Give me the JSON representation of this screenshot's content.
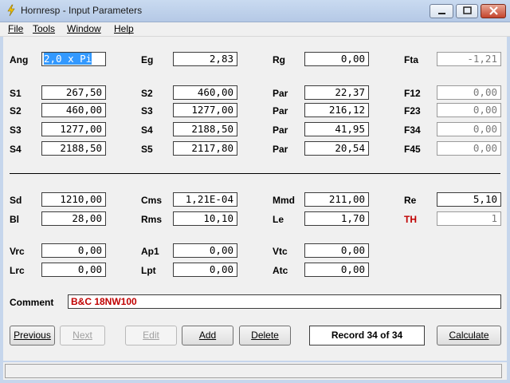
{
  "window": {
    "title": "Hornresp - Input Parameters"
  },
  "menu": [
    "File",
    "Tools",
    "Window",
    "Help"
  ],
  "rows1": [
    [
      {
        "l": "Ang",
        "v": "2,0 x Pi",
        "state": "selected"
      },
      {
        "l": "Eg",
        "v": "2,83"
      },
      {
        "l": "Rg",
        "v": "0,00"
      },
      {
        "l": "Fta",
        "v": "-1,21",
        "state": "readonly"
      }
    ]
  ],
  "rows2": [
    [
      {
        "l": "S1",
        "v": "267,50"
      },
      {
        "l": "S2",
        "v": "460,00"
      },
      {
        "l": "Par",
        "v": "22,37"
      },
      {
        "l": "F12",
        "v": "0,00",
        "state": "readonly"
      }
    ],
    [
      {
        "l": "S2",
        "v": "460,00"
      },
      {
        "l": "S3",
        "v": "1277,00"
      },
      {
        "l": "Par",
        "v": "216,12"
      },
      {
        "l": "F23",
        "v": "0,00",
        "state": "readonly"
      }
    ],
    [
      {
        "l": "S3",
        "v": "1277,00"
      },
      {
        "l": "S4",
        "v": "2188,50"
      },
      {
        "l": "Par",
        "v": "41,95"
      },
      {
        "l": "F34",
        "v": "0,00",
        "state": "readonly"
      }
    ],
    [
      {
        "l": "S4",
        "v": "2188,50"
      },
      {
        "l": "S5",
        "v": "2117,80"
      },
      {
        "l": "Par",
        "v": "20,54"
      },
      {
        "l": "F45",
        "v": "0,00",
        "state": "readonly"
      }
    ]
  ],
  "rows3": [
    [
      {
        "l": "Sd",
        "v": "1210,00"
      },
      {
        "l": "Cms",
        "v": "1,21E-04"
      },
      {
        "l": "Mmd",
        "v": "211,00"
      },
      {
        "l": "Re",
        "v": "5,10"
      }
    ],
    [
      {
        "l": "Bl",
        "v": "28,00"
      },
      {
        "l": "Rms",
        "v": "10,10"
      },
      {
        "l": "Le",
        "v": "1,70"
      },
      {
        "l": "TH",
        "v": "1",
        "state": "readonly",
        "color": "#c00000"
      }
    ]
  ],
  "rows4": [
    [
      {
        "l": "Vrc",
        "v": "0,00"
      },
      {
        "l": "Ap1",
        "v": "0,00"
      },
      {
        "l": "Vtc",
        "v": "0,00"
      }
    ],
    [
      {
        "l": "Lrc",
        "v": "0,00"
      },
      {
        "l": "Lpt",
        "v": "0,00"
      },
      {
        "l": "Atc",
        "v": "0,00"
      }
    ]
  ],
  "comment": {
    "label": "Comment",
    "value": "B&C 18NW100"
  },
  "buttons": {
    "previous": "Previous",
    "next": "Next",
    "edit": "Edit",
    "add": "Add",
    "delete": "Delete",
    "calculate": "Calculate"
  },
  "record": "Record 34 of 34",
  "colors": {
    "accent_red": "#c00000",
    "selection": "#3399ff",
    "titlebar": "#b5c9e6"
  }
}
